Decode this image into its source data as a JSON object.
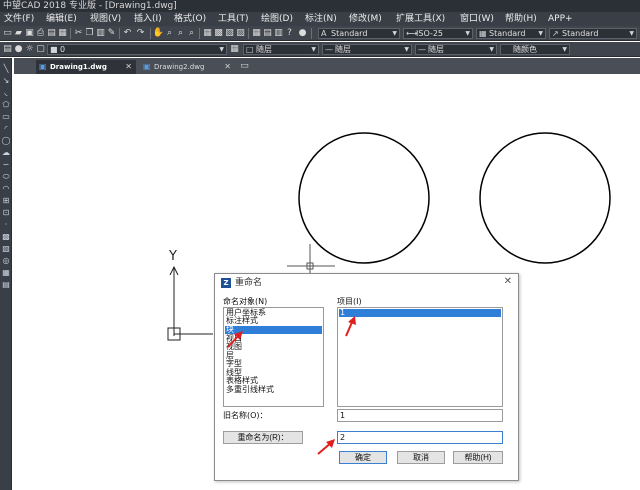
{
  "app": {
    "window_title": "中望CAD 2018 专业版 - [Drawing1.dwg]"
  },
  "menu": [
    {
      "label": "文件(F)"
    },
    {
      "label": "编辑(E)"
    },
    {
      "label": "视图(V)"
    },
    {
      "label": "插入(I)"
    },
    {
      "label": "格式(O)"
    },
    {
      "label": "工具(T)"
    },
    {
      "label": "绘图(D)"
    },
    {
      "label": "标注(N)"
    },
    {
      "label": "修改(M)"
    },
    {
      "label": "扩展工具(X)"
    },
    {
      "label": "窗口(W)"
    },
    {
      "label": "帮助(H)"
    },
    {
      "label": "APP+"
    }
  ],
  "toolbar1": {
    "text_style": "Standard",
    "dim_style": "ISO-25",
    "table_style": "Standard",
    "multileader_style": "Standard"
  },
  "toolbar2": {
    "layer": "0",
    "color": "随层",
    "linetype": "随层",
    "lineweight": "随层",
    "plot_style": "随颜色"
  },
  "tabs": [
    {
      "label": "Drawing1.dwg",
      "active": true
    },
    {
      "label": "Drawing2.dwg",
      "active": false
    }
  ],
  "canvas": {
    "ucs_y_label": "Y"
  },
  "dialog": {
    "title": "重命名",
    "named_objects_label": "命名对象(N)",
    "named_objects": [
      {
        "label": "用户坐标系",
        "selected": false
      },
      {
        "label": "标注样式",
        "selected": false
      },
      {
        "label": "块",
        "selected": true
      },
      {
        "label": "视口",
        "selected": false
      },
      {
        "label": "视图",
        "selected": false
      },
      {
        "label": "层",
        "selected": false
      },
      {
        "label": "字型",
        "selected": false
      },
      {
        "label": "线型",
        "selected": false
      },
      {
        "label": "表格样式",
        "selected": false
      },
      {
        "label": "多重引线样式",
        "selected": false
      }
    ],
    "items_label": "项目(I)",
    "items": [
      {
        "label": "1",
        "selected": true
      }
    ],
    "old_name_label": "旧名称(O)：",
    "old_name_value": "1",
    "rename_to_button": "重命名为(R)：",
    "rename_to_value": "2",
    "ok_button": "确定",
    "cancel_button": "取消",
    "help_button": "帮助(H)"
  },
  "colors": {
    "selection": "#2f7fd8",
    "annotation_arrow": "#e02020",
    "ui_dark": "#3a3f47"
  }
}
